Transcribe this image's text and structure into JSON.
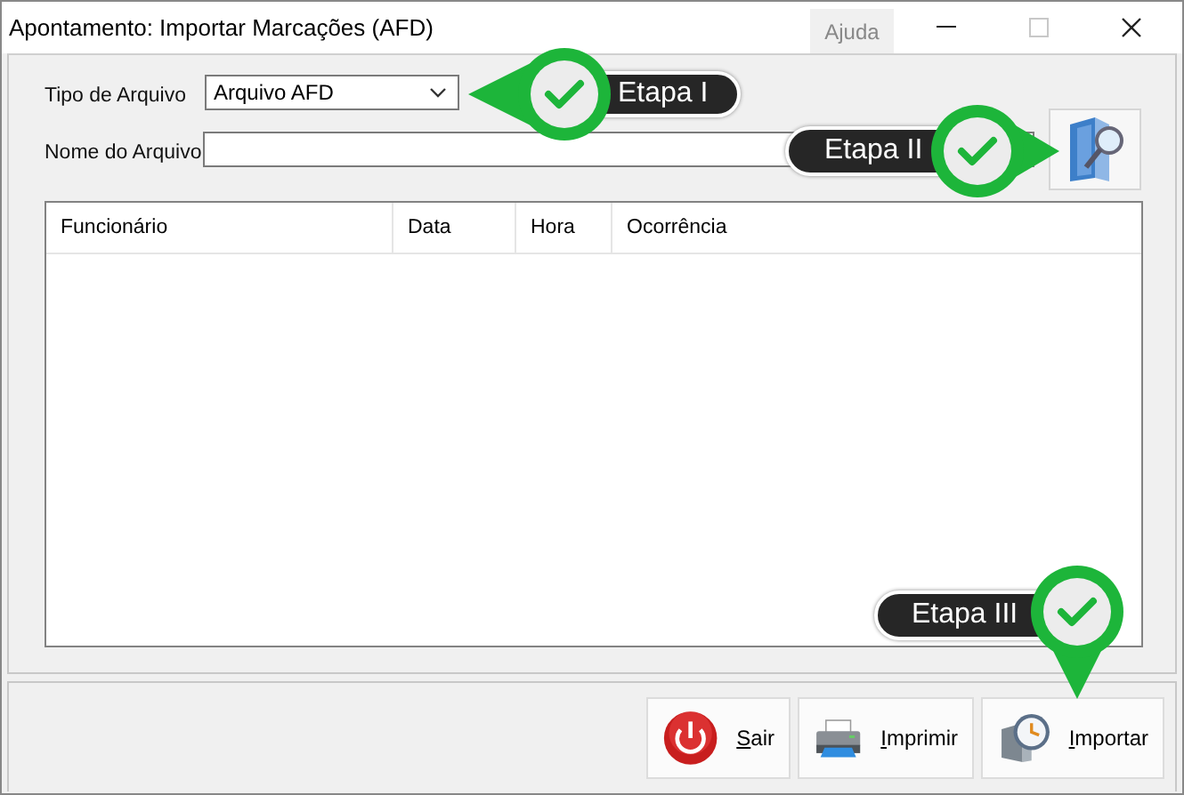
{
  "window": {
    "title": "Apontamento: Importar Marcações (AFD)",
    "help_tab": "Ajuda",
    "controls": [
      {
        "kind": "minimize",
        "disabled": false
      },
      {
        "kind": "maximize",
        "disabled": true
      },
      {
        "kind": "close",
        "disabled": false
      }
    ]
  },
  "form": {
    "file_type": {
      "label": "Tipo de Arquivo",
      "value": "Arquivo AFD"
    },
    "file_name": {
      "label": "Nome do Arquivo"
    }
  },
  "table": {
    "columns": [
      "Funcionário",
      "Data",
      "Hora",
      "Ocorrência"
    ]
  },
  "buttons": [
    {
      "kind": "exit",
      "label": "Sair"
    },
    {
      "kind": "print",
      "label": "Imprimir"
    },
    {
      "kind": "import",
      "label": "Importar"
    }
  ],
  "callouts": [
    {
      "label": "Etapa I",
      "kind": "left"
    },
    {
      "label": "Etapa II",
      "kind": "right"
    },
    {
      "label": "Etapa III",
      "kind": "down"
    }
  ]
}
